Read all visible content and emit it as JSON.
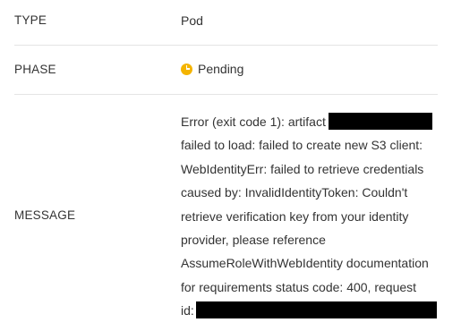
{
  "details": {
    "rows": {
      "type": {
        "key": "TYPE",
        "value": "Pod"
      },
      "phase": {
        "key": "PHASE",
        "value": "Pending",
        "status_icon": "pending-clock-icon",
        "status_color": "#f4b400"
      },
      "message": {
        "key": "MESSAGE",
        "lines": [
          "Error (exit code 1): artifact",
          "failed to load: failed to create new S3 client:",
          "WebIdentityErr: failed to retrieve credentials",
          "caused by: InvalidIdentityToken: Couldn't",
          "retrieve verification key from your identity",
          "provider, please reference",
          "AssumeRoleWithWebIdentity documentation",
          "for requirements status code: 400, request",
          "id:"
        ]
      }
    }
  },
  "colors": {
    "text": "#333333",
    "divider": "#e4e4e4",
    "redaction": "#000000"
  }
}
